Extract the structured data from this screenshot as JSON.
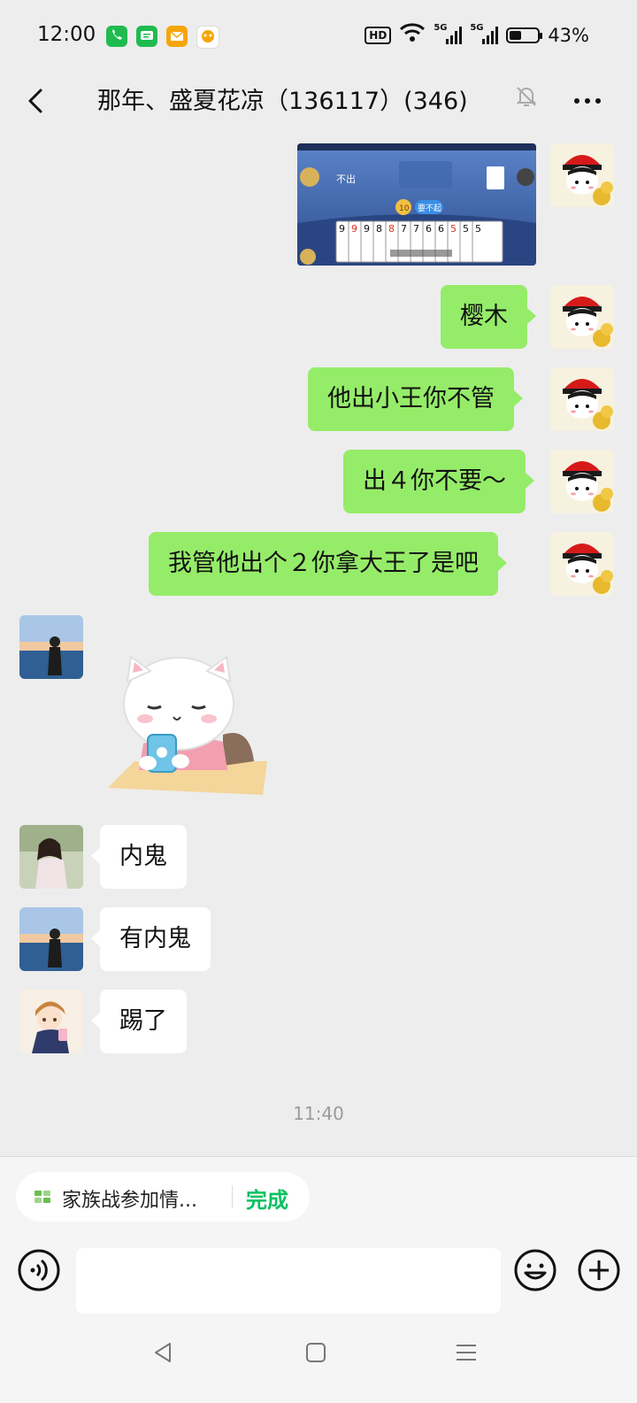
{
  "status_bar": {
    "time": "12:00",
    "hd": "HD",
    "net1": "5G",
    "net2": "5G",
    "battery": "43%",
    "battery_level": 0.43
  },
  "header": {
    "title": "那年、盛夏花凉（136117）(346)"
  },
  "messages": [
    {
      "side": "right",
      "type": "image",
      "alt": "game screenshot"
    },
    {
      "side": "right",
      "type": "text",
      "text": "樱木"
    },
    {
      "side": "right",
      "type": "text",
      "text": "他出小王你不管"
    },
    {
      "side": "right",
      "type": "text",
      "text": "出４你不要～"
    },
    {
      "side": "right",
      "type": "text",
      "text": "我管他出个２你拿大王了是吧"
    },
    {
      "side": "left",
      "type": "sticker",
      "alt": "cat sticker"
    },
    {
      "side": "left",
      "type": "text",
      "text": "内鬼"
    },
    {
      "side": "left",
      "type": "text",
      "text": "有内鬼"
    },
    {
      "side": "left",
      "type": "text",
      "text": "踢了"
    }
  ],
  "timestamp": "11:40",
  "notice": {
    "text": "家族战参加情...",
    "action": "完成"
  },
  "input": {
    "placeholder": ""
  },
  "game_screenshot": {
    "pass_label": "不出",
    "cards": [
      "9",
      "9",
      "9",
      "8",
      "8",
      "7",
      "7",
      "6",
      "6",
      "5",
      "5",
      "5"
    ],
    "button": "要不起",
    "timer": "10"
  },
  "colors": {
    "my_bubble": "#95ec69",
    "their_bubble": "#ffffff",
    "background": "#ededed",
    "accent": "#07c160"
  }
}
